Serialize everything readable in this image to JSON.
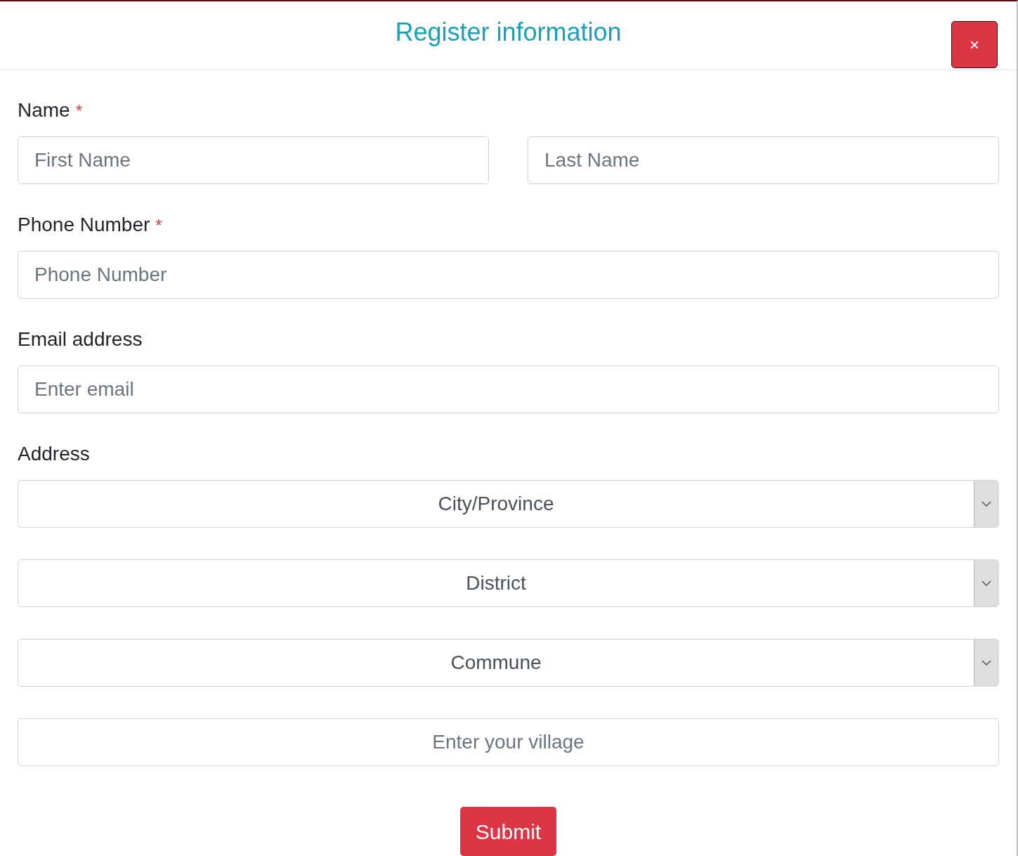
{
  "modal": {
    "title": "Register information",
    "close_label": "×"
  },
  "fields": [
    {
      "kind": "inputs",
      "label": "Name",
      "required_mark": "*",
      "inputs": [
        {
          "placeholder": "First Name"
        },
        {
          "placeholder": "Last Name"
        }
      ]
    },
    {
      "kind": "inputs",
      "label": "Phone Number",
      "required_mark": "*",
      "inputs": [
        {
          "placeholder": "Phone Number"
        }
      ]
    },
    {
      "kind": "inputs",
      "label": "Email address",
      "inputs": [
        {
          "placeholder": "Enter email"
        }
      ]
    },
    {
      "kind": "address",
      "label": "Address",
      "selects": [
        {
          "value": "City/Province"
        },
        {
          "value": "District"
        },
        {
          "value": "Commune"
        }
      ],
      "village": {
        "placeholder": "Enter your village"
      }
    }
  ],
  "submit": {
    "label": "Submit"
  }
}
